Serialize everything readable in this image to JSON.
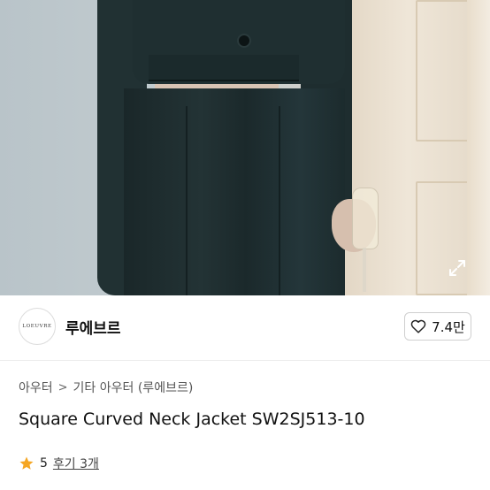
{
  "product": {
    "image": {
      "alt_icon": "expand-icon"
    },
    "seller": {
      "logo_text": "LOEUVRE",
      "name": "루에브르"
    },
    "like": {
      "icon": "heart-outline-icon",
      "count": "7.4만"
    },
    "breadcrumb": {
      "items": [
        "아우터",
        "기타 아우터 (루에브르)"
      ],
      "separator": ">"
    },
    "title": "Square Curved Neck Jacket SW2SJ513-10",
    "rating": {
      "icon": "star-icon",
      "star_color": "#f5a623",
      "score": "5",
      "reviews_label": "후기 3개"
    }
  }
}
